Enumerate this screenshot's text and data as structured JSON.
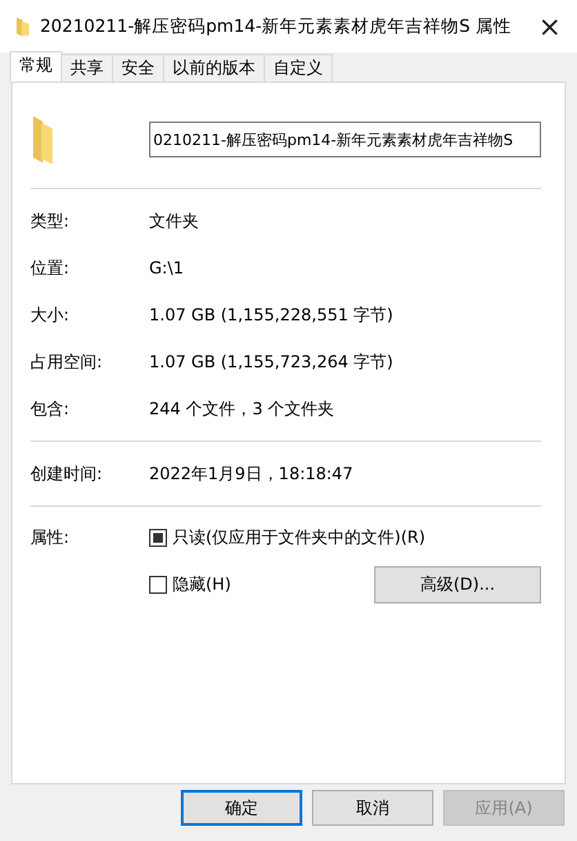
{
  "window": {
    "title": "20210211-解压密码pm14-新年元素素材虎年吉祥物S 属性",
    "close": "×"
  },
  "tabs": [
    {
      "label": "常规",
      "selected": true
    },
    {
      "label": "共享",
      "selected": false
    },
    {
      "label": "安全",
      "selected": false
    },
    {
      "label": "以前的版本",
      "selected": false
    },
    {
      "label": "自定义",
      "selected": false
    }
  ],
  "name_field": {
    "value": "0210211-解压密码pm14-新年元素素材虎年吉祥物S"
  },
  "sections": [
    {
      "rows": [
        {
          "label": "类型:",
          "value": "文件夹"
        },
        {
          "label": "位置:",
          "value": "G:\\1"
        },
        {
          "label": "大小:",
          "value": "1.07 GB (1,155,228,551 字节)"
        },
        {
          "label": "占用空间:",
          "value": "1.07 GB (1,155,723,264 字节)"
        },
        {
          "label": "包含:",
          "value": "244 个文件，3 个文件夹"
        }
      ]
    },
    {
      "rows": [
        {
          "label": "创建时间:",
          "value": "2022年1月9日，18:18:47"
        }
      ]
    }
  ],
  "attributes": {
    "label": "属性:",
    "options": [
      {
        "label": "只读(仅应用于文件夹中的文件)(R)",
        "checked": false,
        "indeterminate": true
      },
      {
        "label": "隐藏(H)",
        "checked": false,
        "indeterminate": false
      }
    ],
    "advanced": "高级(D)..."
  },
  "buttons": [
    {
      "label": "确定",
      "kind": "default",
      "disabled": false
    },
    {
      "label": "取消",
      "kind": "normal",
      "disabled": false
    },
    {
      "label": "应用(A)",
      "kind": "normal",
      "disabled": true
    }
  ]
}
